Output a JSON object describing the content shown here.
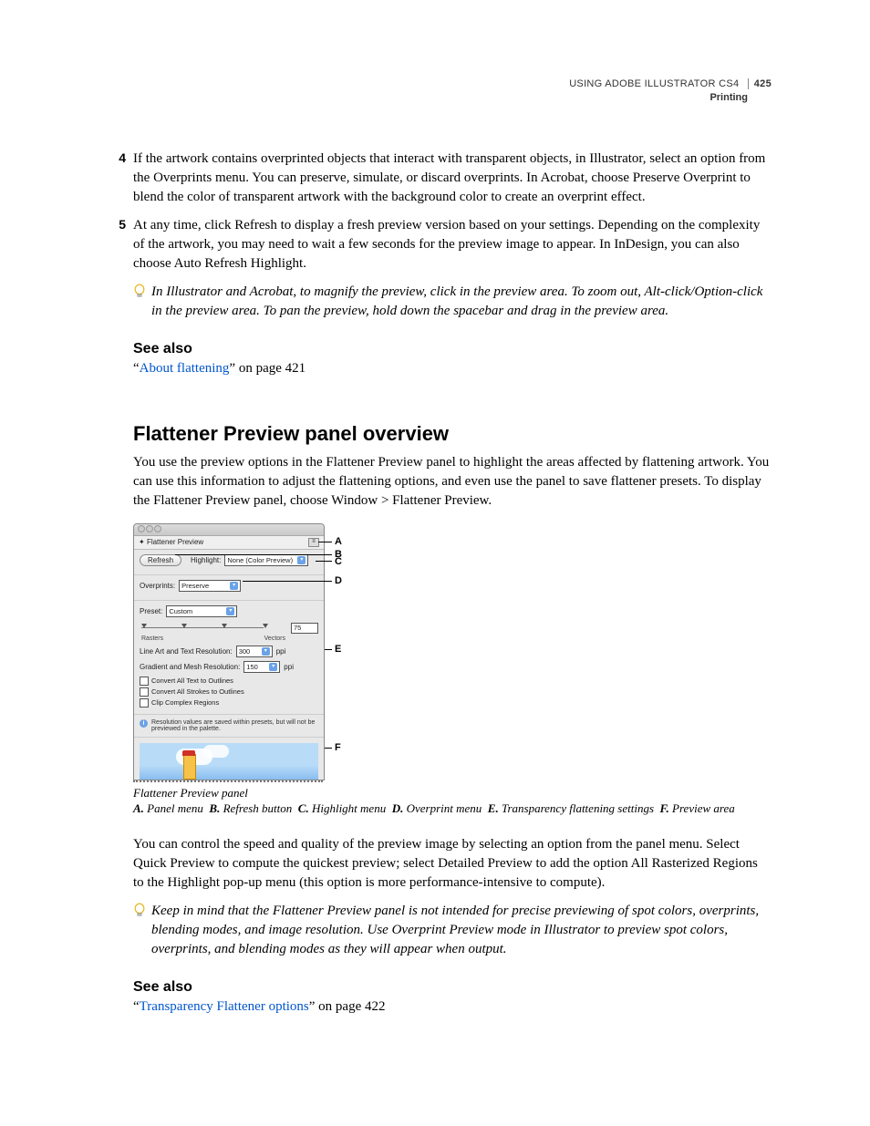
{
  "header": {
    "doc_title": "USING ADOBE ILLUSTRATOR CS4",
    "page_number": "425",
    "section": "Printing"
  },
  "steps": {
    "step4": {
      "num": "4",
      "text": "If the artwork contains overprinted objects that interact with transparent objects, in Illustrator, select an option from the Overprints menu. You can preserve, simulate, or discard overprints. In Acrobat, choose Preserve Overprint to blend the color of transparent artwork with the background color to create an overprint effect."
    },
    "step5": {
      "num": "5",
      "text": "At any time, click Refresh to display a fresh preview version based on your settings. Depending on the complexity of the artwork, you may need to wait a few seconds for the preview image to appear. In InDesign, you can also choose Auto Refresh Highlight."
    }
  },
  "tip1": "In Illustrator and Acrobat, to magnify the preview, click in the preview area. To zoom out, Alt-click/Option-click in the preview area. To pan the preview, hold down the spacebar and drag in the preview area.",
  "seealso1": {
    "heading": "See also",
    "prefix": "“",
    "link": "About flattening",
    "suffix": "” on page 421"
  },
  "section_title": "Flattener Preview panel overview",
  "intro": "You use the preview options in the Flattener Preview panel to highlight the areas affected by flattening artwork. You can use this information to adjust the flattening options, and even use the panel to save flattener presets. To display the Flattener Preview panel, choose Window > Flattener Preview.",
  "panel": {
    "tab_title": "Flattener Preview",
    "refresh": "Refresh",
    "highlight_label": "Highlight:",
    "highlight_value": "None (Color Preview)",
    "overprints_label": "Overprints:",
    "overprints_value": "Preserve",
    "preset_label": "Preset:",
    "preset_value": "Custom",
    "slider_value": "75",
    "slider_left": "Rasters",
    "slider_right": "Vectors",
    "lineart_label": "Line Art and Text Resolution:",
    "lineart_value": "300",
    "gradient_label": "Gradient and Mesh Resolution:",
    "gradient_value": "150",
    "ppi": "ppi",
    "chk1": "Convert All Text to Outlines",
    "chk2": "Convert All Strokes to Outlines",
    "chk3": "Clip Complex Regions",
    "info": "Resolution values are saved within presets, but will not be previewed in the palette."
  },
  "callouts": {
    "A": "A",
    "B": "B",
    "C": "C",
    "D": "D",
    "E": "E",
    "F": "F"
  },
  "caption": {
    "title": "Flattener Preview panel",
    "A": "Panel menu",
    "B": "Refresh button",
    "C": "Highlight menu",
    "D": "Overprint menu",
    "E": "Transparency flattening settings",
    "F": "Preview area"
  },
  "para_after_fig": "You can control the speed and quality of the preview image by selecting an option from the panel menu. Select Quick Preview to compute the quickest preview; select Detailed Preview to add the option All Rasterized Regions to the Highlight pop-up menu (this option is more performance-intensive to compute).",
  "tip2": "Keep in mind that the Flattener Preview panel is not intended for precise previewing of spot colors, overprints, blending modes, and image resolution. Use Overprint Preview mode in Illustrator to preview spot colors, overprints, and blending modes as they will appear when output.",
  "seealso2": {
    "heading": "See also",
    "prefix": "“",
    "link": "Transparency Flattener options",
    "suffix": "” on page 422"
  }
}
